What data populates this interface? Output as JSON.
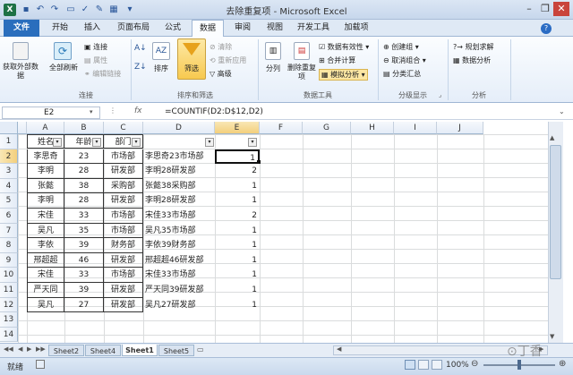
{
  "window": {
    "title": "去除重复项 - Microsoft Excel"
  },
  "tabs": [
    "文件",
    "开始",
    "插入",
    "页面布局",
    "公式",
    "数据",
    "审阅",
    "视图",
    "开发工具",
    "加载项"
  ],
  "ribbon": {
    "get_external": "获取外部数据",
    "refresh_all": "全部刷新",
    "connections": "连接",
    "properties": "属性",
    "edit_links": "编辑链接",
    "sort": "排序",
    "filter": "筛选",
    "clear": "清除",
    "reapply": "重新应用",
    "advanced": "高级",
    "text_to_columns": "分列",
    "remove_duplicates": "删除重复项",
    "data_validation": "数据有效性",
    "consolidate": "合并计算",
    "what_if": "模拟分析",
    "group": "创建组",
    "ungroup": "取消组合",
    "subtotal": "分类汇总",
    "solver": "规划求解",
    "data_analysis": "数据分析",
    "groups": {
      "connections": "连接",
      "sort_filter": "排序和筛选",
      "data_tools": "数据工具",
      "outline": "分级显示",
      "analysis": "分析"
    }
  },
  "formula_bar": {
    "name_box": "E2",
    "fx": "fx",
    "formula": "=COUNTIF(D2:D$12,D2)"
  },
  "columns": [
    "A",
    "B",
    "C",
    "D",
    "E",
    "F",
    "G",
    "H",
    "I",
    "J"
  ],
  "rows": [
    "1",
    "2",
    "3",
    "4",
    "5",
    "6",
    "7",
    "8",
    "9",
    "10",
    "11",
    "12",
    "13",
    "14"
  ],
  "headers": {
    "a": "姓名",
    "b": "年龄",
    "c": "部门"
  },
  "table": [
    {
      "a": "李思奇",
      "b": "23",
      "c": "市场部",
      "d": "李思奇23市场部",
      "e": "1"
    },
    {
      "a": "李明",
      "b": "28",
      "c": "研发部",
      "d": "李明28研发部",
      "e": "2"
    },
    {
      "a": "张懿",
      "b": "38",
      "c": "采购部",
      "d": "张懿38采购部",
      "e": "1"
    },
    {
      "a": "李明",
      "b": "28",
      "c": "研发部",
      "d": "李明28研发部",
      "e": "1"
    },
    {
      "a": "宋佳",
      "b": "33",
      "c": "市场部",
      "d": "宋佳33市场部",
      "e": "2"
    },
    {
      "a": "吴凡",
      "b": "35",
      "c": "市场部",
      "d": "吴凡35市场部",
      "e": "1"
    },
    {
      "a": "李依",
      "b": "39",
      "c": "财务部",
      "d": "李依39财务部",
      "e": "1"
    },
    {
      "a": "邢超超",
      "b": "46",
      "c": "研发部",
      "d": "邢超超46研发部",
      "e": "1"
    },
    {
      "a": "宋佳",
      "b": "33",
      "c": "市场部",
      "d": "宋佳33市场部",
      "e": "1"
    },
    {
      "a": "严天同",
      "b": "39",
      "c": "研发部",
      "d": "严天同39研发部",
      "e": "1"
    },
    {
      "a": "吴凡",
      "b": "27",
      "c": "研发部",
      "d": "吴凡27研发部",
      "e": "1"
    }
  ],
  "sheets": [
    "Sheet2",
    "Sheet4",
    "Sheet1",
    "Sheet5"
  ],
  "status": {
    "ready": "就绪",
    "zoom": "100%"
  },
  "watermark": "丁香",
  "colors": {
    "file_tab": "#2a6ebd",
    "selection": "#217346",
    "excel_green": "#1e7145"
  }
}
